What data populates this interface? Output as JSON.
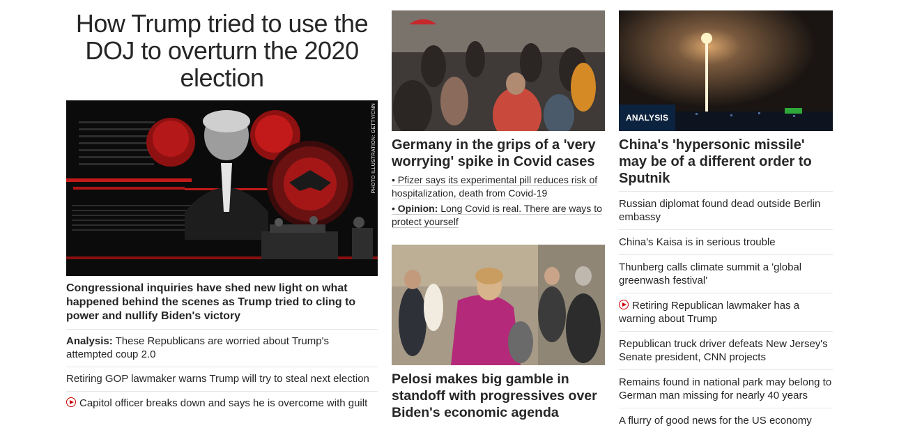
{
  "left": {
    "headline": "How Trump tried to use the DOJ to overturn the 2020 election",
    "image_credit": "PHOTO ILLUSTRATION: GETTY/CNN",
    "caption": "Congressional inquiries have shed new light on what happened behind the scenes as Trump tried to cling to power and nullify Biden's victory",
    "items": [
      {
        "prefix": "Analysis:",
        "text": "These Republicans are worried about Trump's attempted coup 2.0",
        "video": false
      },
      {
        "prefix": "",
        "text": "Retiring GOP lawmaker warns Trump will try to steal next election",
        "video": false
      },
      {
        "prefix": "",
        "text": "Capitol officer breaks down and says he is overcome with guilt",
        "video": true
      }
    ]
  },
  "middle": {
    "top_story": {
      "title": "Germany in the grips of a 'very worrying' spike in Covid cases",
      "subs": [
        {
          "prefix": "",
          "text": "Pfizer says its experimental pill reduces risk of hospitalization, death from Covid-19"
        },
        {
          "prefix": "Opinion:",
          "text": "Long Covid is real. There are ways to protect yourself"
        }
      ]
    },
    "second_story": {
      "title": "Pelosi makes big gamble in standoff with progressives over Biden's economic agenda"
    }
  },
  "right": {
    "badge": "ANALYSIS",
    "title": "China's 'hypersonic missile' may be of a different order to Sputnik",
    "items": [
      {
        "text": "Russian diplomat found dead outside Berlin embassy",
        "video": false
      },
      {
        "text": "China's Kaisa is in serious trouble",
        "video": false
      },
      {
        "text": "Thunberg calls climate summit a 'global greenwash festival'",
        "video": false
      },
      {
        "text": "Retiring Republican lawmaker has a warning about Trump",
        "video": true
      },
      {
        "text": "Republican truck driver defeats New Jersey's Senate president, CNN projects",
        "video": false
      },
      {
        "text": "Remains found in national park may belong to German man missing for nearly 40 years",
        "video": false
      },
      {
        "text": "A flurry of good news for the US economy",
        "video": false
      }
    ]
  },
  "colors": {
    "text": "#262626",
    "accent_red": "#cc0000",
    "badge_bg": "#0c2340",
    "divider": "#e6e6e6"
  }
}
